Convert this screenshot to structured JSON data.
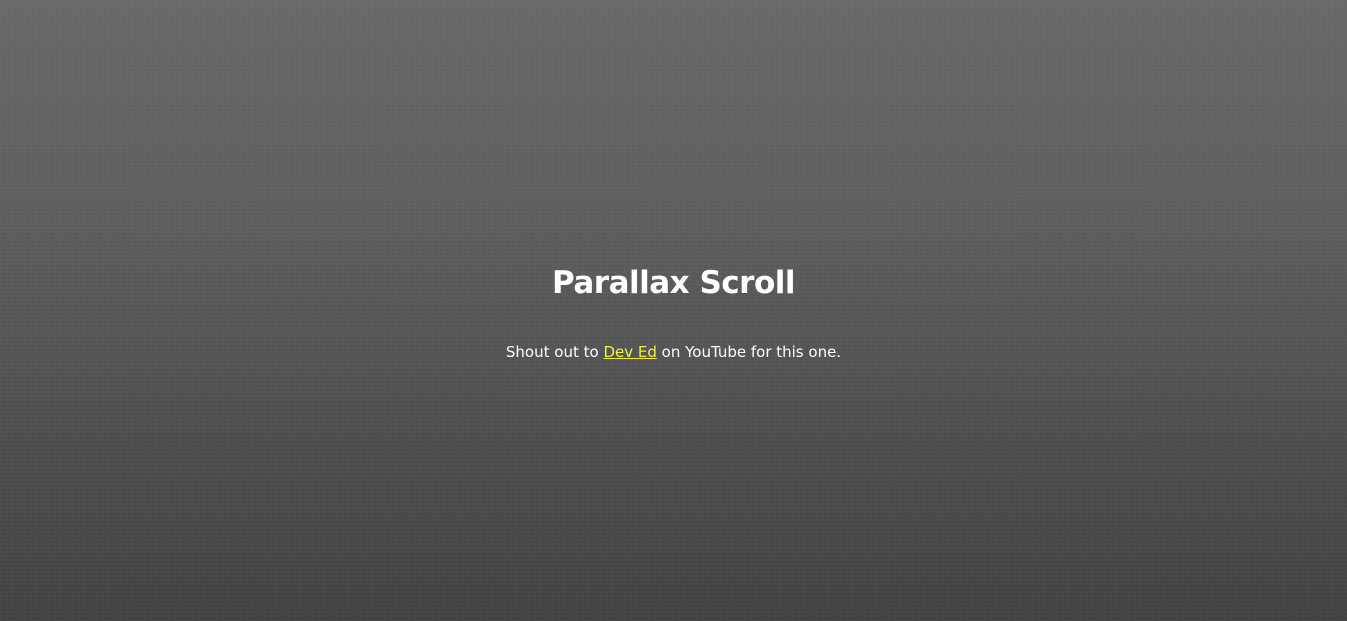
{
  "hero": {
    "title": "Parallax Scroll",
    "subtitle_before": "Shout out to ",
    "link_text": "Dev Ed",
    "subtitle_after": " on YouTube for this one."
  },
  "colors": {
    "background": "#5f5f62",
    "text": "#ffffff",
    "link": "#f2f23a"
  }
}
